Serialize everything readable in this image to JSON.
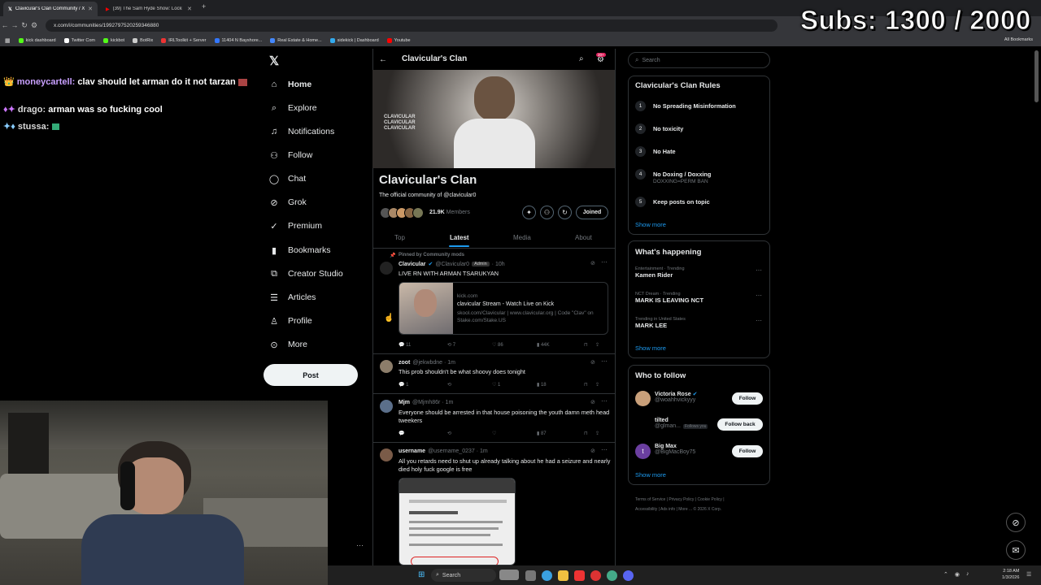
{
  "browser": {
    "tabs": [
      {
        "label": "Clavicular's Clan Community / X",
        "active": true
      },
      {
        "label": "(39) The Sam Hyde Show: Lockin",
        "active": false
      }
    ],
    "url": "x.com/i/communities/1992797520259346880",
    "bookmarks": [
      "kick dashboard",
      "Twitter Com",
      "kickbot",
      "BotRix",
      "IRLToolkit + Server",
      "11404 N Bayshore...",
      "Real Estate & Home...",
      "sidekick | Dashboard",
      "Youtube"
    ],
    "all_bookmarks": "All Bookmarks"
  },
  "overlay": {
    "subs": "Subs: 1300 / 2000"
  },
  "chat": [
    {
      "user": "moneycartell:",
      "msg": "clav should let arman do it not tarzan"
    },
    {
      "user": "drago:",
      "msg": "arman was so fucking cool"
    },
    {
      "user": "stussa:",
      "msg": ""
    }
  ],
  "sidebar": {
    "items": [
      {
        "label": "Home",
        "icon": "home-icon"
      },
      {
        "label": "Explore",
        "icon": "search-icon"
      },
      {
        "label": "Notifications",
        "icon": "bell-icon"
      },
      {
        "label": "Follow",
        "icon": "person-add-icon"
      },
      {
        "label": "Chat",
        "icon": "chat-icon"
      },
      {
        "label": "Grok",
        "icon": "grok-icon"
      },
      {
        "label": "Premium",
        "icon": "premium-icon"
      },
      {
        "label": "Bookmarks",
        "icon": "bookmark-icon"
      },
      {
        "label": "Creator Studio",
        "icon": "creator-icon"
      },
      {
        "label": "Articles",
        "icon": "articles-icon"
      },
      {
        "label": "Profile",
        "icon": "profile-icon"
      },
      {
        "label": "More",
        "icon": "more-icon"
      }
    ],
    "post_label": "Post"
  },
  "community": {
    "header_title": "Clavicular's Clan",
    "notif_badge": "20+",
    "name": "Clavicular's Clan",
    "description": "The official community of @clavicular0",
    "members_count": "21.9K",
    "members_label": "Members",
    "joined_label": "Joined",
    "tabs": [
      "Top",
      "Latest",
      "Media",
      "About"
    ],
    "active_tab": "Latest"
  },
  "posts": [
    {
      "pinned": "Pinned by Community mods",
      "name": "Clavicular",
      "handle": "@Clavicular0",
      "badge": "Admin",
      "time": "· 10h",
      "text": "LIVE RN WITH ARMAN TSARUKYAN",
      "card": {
        "domain": "kick.com",
        "title": "clavicular Stream - Watch Live on Kick",
        "desc": "skool.com/Clavicular | www.clavicular.org | Code \"Clav\" on Stake.com/Stake.US"
      },
      "stats": {
        "replies": "11",
        "reposts": "7",
        "likes": "86",
        "views": "44K"
      }
    },
    {
      "name": "zoot",
      "handle": "@jekwbdne · 1m",
      "text": "This prob shouldn't be what shoovy does tonight",
      "stats": {
        "replies": "1",
        "reposts": "",
        "likes": "1",
        "views": "18"
      }
    },
    {
      "name": "Mjm",
      "handle": "@Mjmh86r · 1m",
      "text": "Everyone should be arrested in that house poisoning the youth damn meth head tweekers",
      "stats": {
        "replies": "",
        "reposts": "",
        "likes": "",
        "views": "87"
      }
    },
    {
      "name": "username",
      "handle": "@username_0237 · 1m",
      "text": "All you retards need to shut up already talking about he had a seizure and nearly died holy fuck google is free"
    }
  ],
  "right": {
    "search_placeholder": "Search",
    "rules_title": "Clavicular's Clan Rules",
    "rules": [
      {
        "num": "1",
        "text": "No Spreading Misinformation",
        "sub": ""
      },
      {
        "num": "2",
        "text": "No toxicity",
        "sub": ""
      },
      {
        "num": "3",
        "text": "No Hate",
        "sub": ""
      },
      {
        "num": "4",
        "text": "No Doxing / Doxxing",
        "sub": "DOXXING=PERM BAN"
      },
      {
        "num": "5",
        "text": "Keep posts on topic",
        "sub": ""
      }
    ],
    "show_more": "Show more",
    "happening_title": "What's happening",
    "trends": [
      {
        "cat": "Entertainment · Trending",
        "name": "Kamen Rider"
      },
      {
        "cat": "NCT Dream · Trending",
        "name": "MARK IS LEAVING NCT"
      },
      {
        "cat": "Trending in United States",
        "name": "MARK LEE"
      }
    ],
    "wtf_title": "Who to follow",
    "follows": [
      {
        "name": "Victoria Rose",
        "handle": "@woahhvickyyy",
        "btn": "Follow",
        "extra": ""
      },
      {
        "name": "tilted",
        "handle": "@glman...",
        "btn": "Follow back",
        "extra": "Follows you"
      },
      {
        "name": "Big Max",
        "handle": "@BigMacBoy75",
        "btn": "Follow",
        "extra": ""
      }
    ],
    "footer": [
      "Terms of Service",
      "Privacy Policy",
      "Cookie Policy",
      "Accessibility",
      "Ads info",
      "More ...",
      "© 2026 X Corp."
    ]
  },
  "taskbar": {
    "search": "Search",
    "time": "2:18 AM",
    "date": "1/3/2026"
  },
  "colors": {
    "accent": "#1d9bf0",
    "bg": "#000000",
    "border": "#2f3336",
    "muted": "#71767b"
  }
}
